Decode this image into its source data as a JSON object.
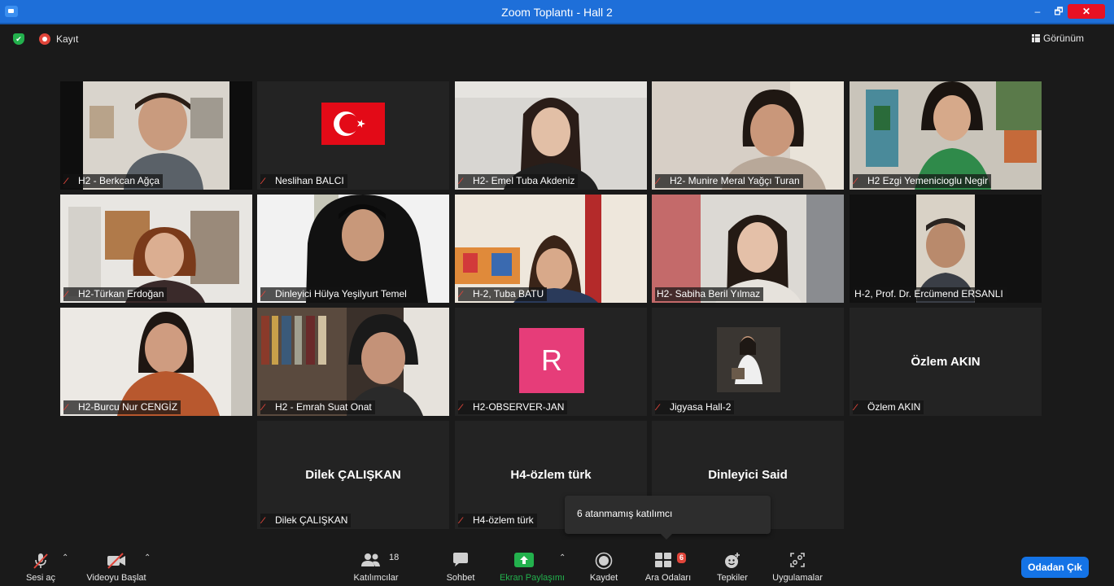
{
  "window": {
    "title": "Zoom Toplantı - Hall 2",
    "minimize": "–",
    "maximize": "🗗",
    "close": "✕"
  },
  "meeting": {
    "record_label": "Kayıt",
    "view_label": "Görünüm"
  },
  "participants": [
    {
      "name": "H2 - Berkcan Ağça",
      "muted": true,
      "type": "video"
    },
    {
      "name": "Neslihan BALCI",
      "muted": true,
      "type": "flag"
    },
    {
      "name": "H2- Emel Tuba Akdeniz",
      "muted": true,
      "type": "video"
    },
    {
      "name": "H2- Munire Meral Yağçı Turan",
      "muted": true,
      "type": "video"
    },
    {
      "name": "H2 Ezgi Yemenicioglu Negir",
      "muted": true,
      "type": "video"
    },
    {
      "name": "H2-Türkan Erdoğan",
      "muted": true,
      "type": "video"
    },
    {
      "name": "Dinleyici Hülya Yeşilyurt Temel",
      "muted": true,
      "type": "video"
    },
    {
      "name": "H-2, Tuba BATU",
      "muted": true,
      "type": "video"
    },
    {
      "name": "H2- Sabiha Beril Yılmaz",
      "muted": false,
      "type": "video"
    },
    {
      "name": "H-2, Prof. Dr. Ercümend ERSANLI",
      "muted": false,
      "type": "video",
      "active_speaker": true
    },
    {
      "name": "H2-Burcu Nur CENGİZ",
      "muted": true,
      "type": "video"
    },
    {
      "name": "H2 - Emrah Suat Onat",
      "muted": true,
      "type": "video"
    },
    {
      "name": "H2-OBSERVER-JAN",
      "muted": true,
      "type": "avatar",
      "avatar_letter": "R"
    },
    {
      "name": "Jigyasa Hall-2",
      "muted": true,
      "type": "photo"
    },
    {
      "name": "Özlem AKIN",
      "muted": true,
      "type": "name",
      "display_name": "Özlem AKIN"
    },
    {
      "name": "Dilek  ÇALIŞKAN",
      "muted": true,
      "type": "name",
      "display_name": "Dilek  ÇALIŞKAN"
    },
    {
      "name": "H4-özlem türk",
      "muted": true,
      "type": "name",
      "display_name": "H4-özlem türk"
    },
    {
      "name": "Dinleyici Said",
      "muted": true,
      "type": "name",
      "display_name": "Dinleyici Said"
    }
  ],
  "tooltip": {
    "text": "6 atanmamış katılımcı"
  },
  "toolbar": {
    "unmute": "Sesi aç",
    "start_video": "Videoyu Başlat",
    "participants": "Katılımcılar",
    "participants_count": "18",
    "chat": "Sohbet",
    "share_screen": "Ekran Paylaşımı",
    "record": "Kaydet",
    "breakout_rooms": "Ara Odaları",
    "breakout_badge": "6",
    "reactions": "Tepkiler",
    "apps": "Uygulamalar",
    "leave": "Odadan Çık"
  },
  "colors": {
    "accent": "#1473e6",
    "share_green": "#23b14d",
    "muted_red": "#e0453a",
    "active_outline": "#d7e07a",
    "avatar_pink": "#e63d79"
  }
}
